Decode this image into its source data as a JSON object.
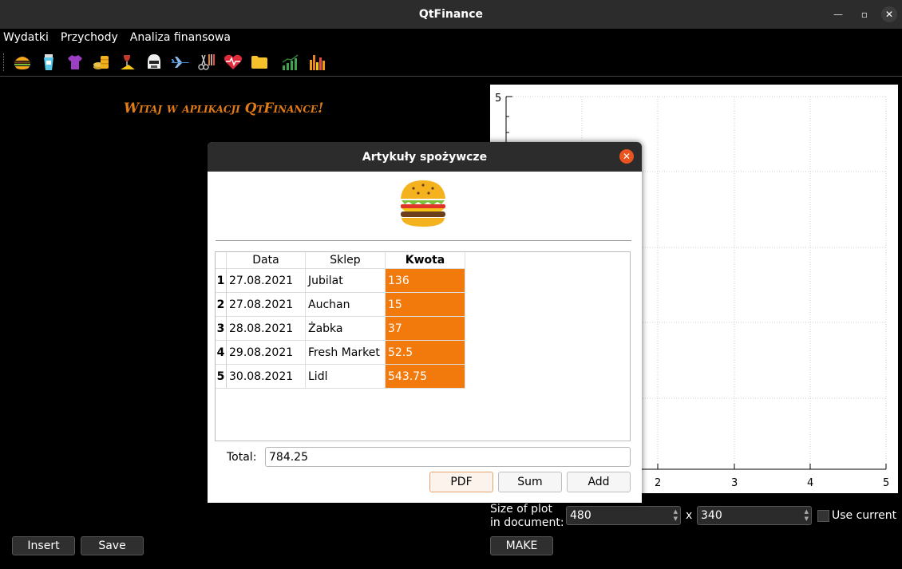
{
  "window": {
    "title": "QtFinance"
  },
  "menu": [
    "Wydatki",
    "Przychody",
    "Analiza finansowa"
  ],
  "toolbar_icons": [
    "burger-icon",
    "cosmetics-icon",
    "tshirt-icon",
    "coins-icon",
    "wine-cheese-icon",
    "helmet-icon",
    "airplane-icon",
    "scissors-icon",
    "heart-icon",
    "folder-icon",
    "growth-chart-icon",
    "bar-chart-icon"
  ],
  "welcome": "Witaj w aplikacji QtFinance!",
  "plot": {
    "y_top_tick": "5",
    "x_ticks": [
      "2",
      "3",
      "4",
      "5"
    ]
  },
  "size_controls": {
    "label_line1": "Size of plot",
    "label_line2": "in document:",
    "width": "480",
    "separator": "x",
    "height": "340",
    "use_current": "Use current",
    "make": "MAKE"
  },
  "left_buttons": {
    "insert": "Insert",
    "save": "Save"
  },
  "dialog": {
    "title": "Artykuły spożywcze",
    "headers": {
      "date": "Data",
      "shop": "Sklep",
      "amount": "Kwota"
    },
    "rows": [
      {
        "n": "1",
        "date": "27.08.2021",
        "shop": "Jubilat",
        "amount": "136"
      },
      {
        "n": "2",
        "date": "27.08.2021",
        "shop": "Auchan",
        "amount": "15"
      },
      {
        "n": "3",
        "date": "28.08.2021",
        "shop": "Żabka",
        "amount": "37"
      },
      {
        "n": "4",
        "date": "29.08.2021",
        "shop": "Fresh Market",
        "amount": "52.5"
      },
      {
        "n": "5",
        "date": "30.08.2021",
        "shop": "Lidl",
        "amount": "543.75"
      }
    ],
    "total_label": "Total:",
    "total_value": "784.25",
    "buttons": {
      "pdf": "PDF",
      "sum": "Sum",
      "add": "Add"
    }
  },
  "colors": {
    "accent": "#f27a0d",
    "welcome": "#e07b16",
    "close": "#e95420"
  }
}
